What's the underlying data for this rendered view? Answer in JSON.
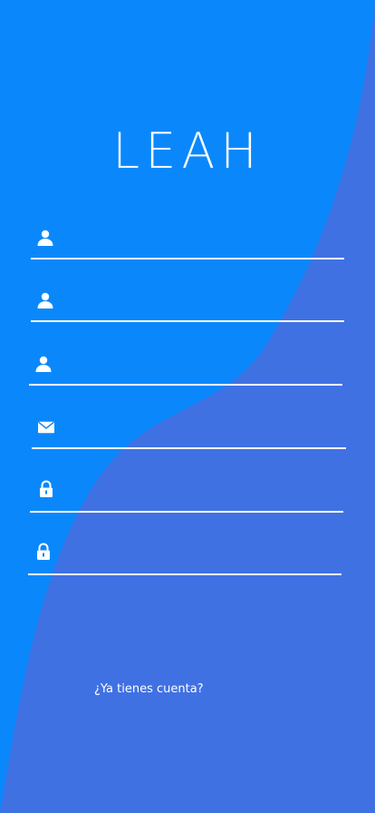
{
  "app": {
    "logo": "LEAH"
  },
  "colors": {
    "background": "#0a88fb",
    "wave": "#4071e3",
    "line": "#ffffff"
  },
  "form": {
    "fields": [
      {
        "icon": "user-icon",
        "placeholder": ""
      },
      {
        "icon": "user-icon",
        "placeholder": ""
      },
      {
        "icon": "user-icon",
        "placeholder": ""
      },
      {
        "icon": "envelope-icon",
        "placeholder": ""
      },
      {
        "icon": "lock-icon",
        "placeholder": ""
      },
      {
        "icon": "lock-icon",
        "placeholder": ""
      }
    ]
  },
  "footer": {
    "login_prompt": "¿Ya tienes cuenta?"
  }
}
